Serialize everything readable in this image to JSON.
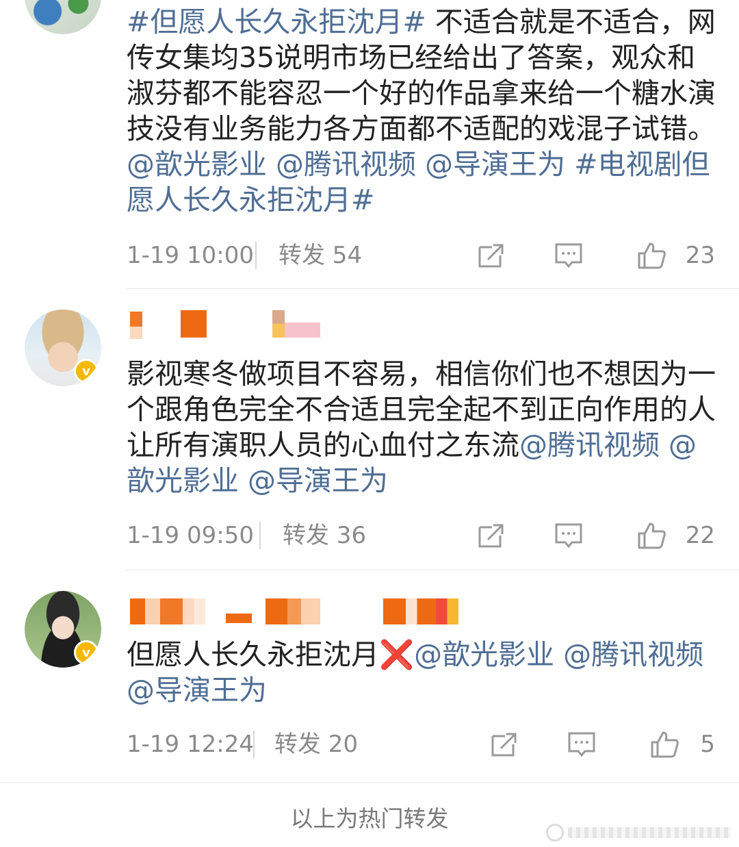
{
  "posts": [
    {
      "parts": [
        {
          "text": "#但愿人长久永拒沈月#",
          "link": true
        },
        {
          "text": " 不适合就是不适合，网传女集均35说明市场已经给出了答案，观众和淑芬都不能容忍一个好的作品拿来给一个糖水演技没有业务能力各方面都不适配的戏混子试错。",
          "link": false
        },
        {
          "text": "@歆光影业",
          "link": true
        },
        {
          "text": " ",
          "link": false
        },
        {
          "text": "@腾讯视频",
          "link": true
        },
        {
          "text": " ",
          "link": false
        },
        {
          "text": "@导演王为",
          "link": true
        },
        {
          "text": "  ",
          "link": false
        },
        {
          "text": "#电视剧但愿人长久永拒沈月#",
          "link": true
        }
      ],
      "time": "1-19 10:00",
      "repost": "转发 54",
      "likes": "23"
    },
    {
      "parts": [
        {
          "text": "影视寒冬做项目不容易，相信你们也不想因为一个跟角色完全不合适且完全起不到正向作用的人让所有演职人员的心血付之东流",
          "link": false
        },
        {
          "text": "@腾讯视频",
          "link": true
        },
        {
          "text": " ",
          "link": false
        },
        {
          "text": "@歆光影业",
          "link": true
        },
        {
          "text": " ",
          "link": false
        },
        {
          "text": "@导演王为",
          "link": true
        }
      ],
      "time": "1-19 09:50",
      "repost": "转发 36",
      "likes": "22"
    },
    {
      "parts": [
        {
          "text": "但愿人长久永拒沈月",
          "link": false
        },
        {
          "text": "❌",
          "link": false,
          "emoji": true
        },
        {
          "text": "@歆光影业",
          "link": true
        },
        {
          "text": " ",
          "link": false
        },
        {
          "text": "@腾讯视频",
          "link": true
        },
        {
          "text": " ",
          "link": false
        },
        {
          "text": "@导演王为",
          "link": true
        }
      ],
      "time": "1-19 12:24",
      "repost": "转发 20",
      "likes": "5"
    }
  ],
  "footer": {
    "text": "以上为热门转发"
  },
  "colors": {
    "link": "#4f6e94",
    "meta": "#8a8a8a",
    "verified": "#f5b800",
    "emoji_x": "#e0261f"
  },
  "icons": [
    "repost-icon",
    "comment-icon",
    "like-icon",
    "verified-icon"
  ]
}
